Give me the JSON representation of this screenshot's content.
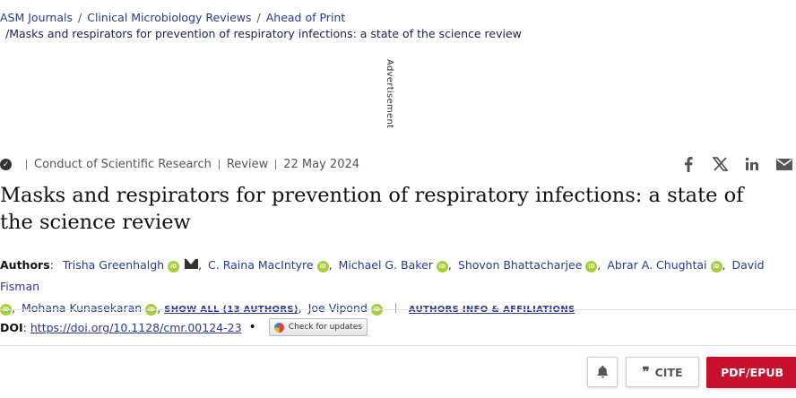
{
  "breadcrumb": {
    "items": [
      "ASM Journals",
      "Clinical Microbiology Reviews",
      "Ahead of Print"
    ],
    "current": "Masks and respirators for prevention of respiratory infections: a state of the science review"
  },
  "advertisement": "Advertisement",
  "article_meta": {
    "category": "Conduct of Scientific Research",
    "type": "Review",
    "date": "22 May 2024"
  },
  "title": "Masks and respirators for prevention of respiratory infections: a state of the science review",
  "authors_label": "Authors",
  "authors": [
    "Trisha Greenhalgh",
    "C. Raina MacIntyre",
    "Michael G. Baker",
    "Shovon Bhattacharjee",
    "Abrar A. Chughtai",
    "David Fisman",
    "Mohana Kunasekaran",
    "Joe Vipond"
  ],
  "show_all": "SHOW ALL (13 AUTHORS)",
  "affiliations": "AUTHORS INFO & AFFILIATIONS",
  "orcid": "iD",
  "doi_label": "DOI",
  "doi": "https://doi.org/10.1128/cmr.00124-23",
  "check_updates": "Check for updates",
  "actions": {
    "cite": "CITE",
    "pdf": "PDF/EPUB"
  }
}
